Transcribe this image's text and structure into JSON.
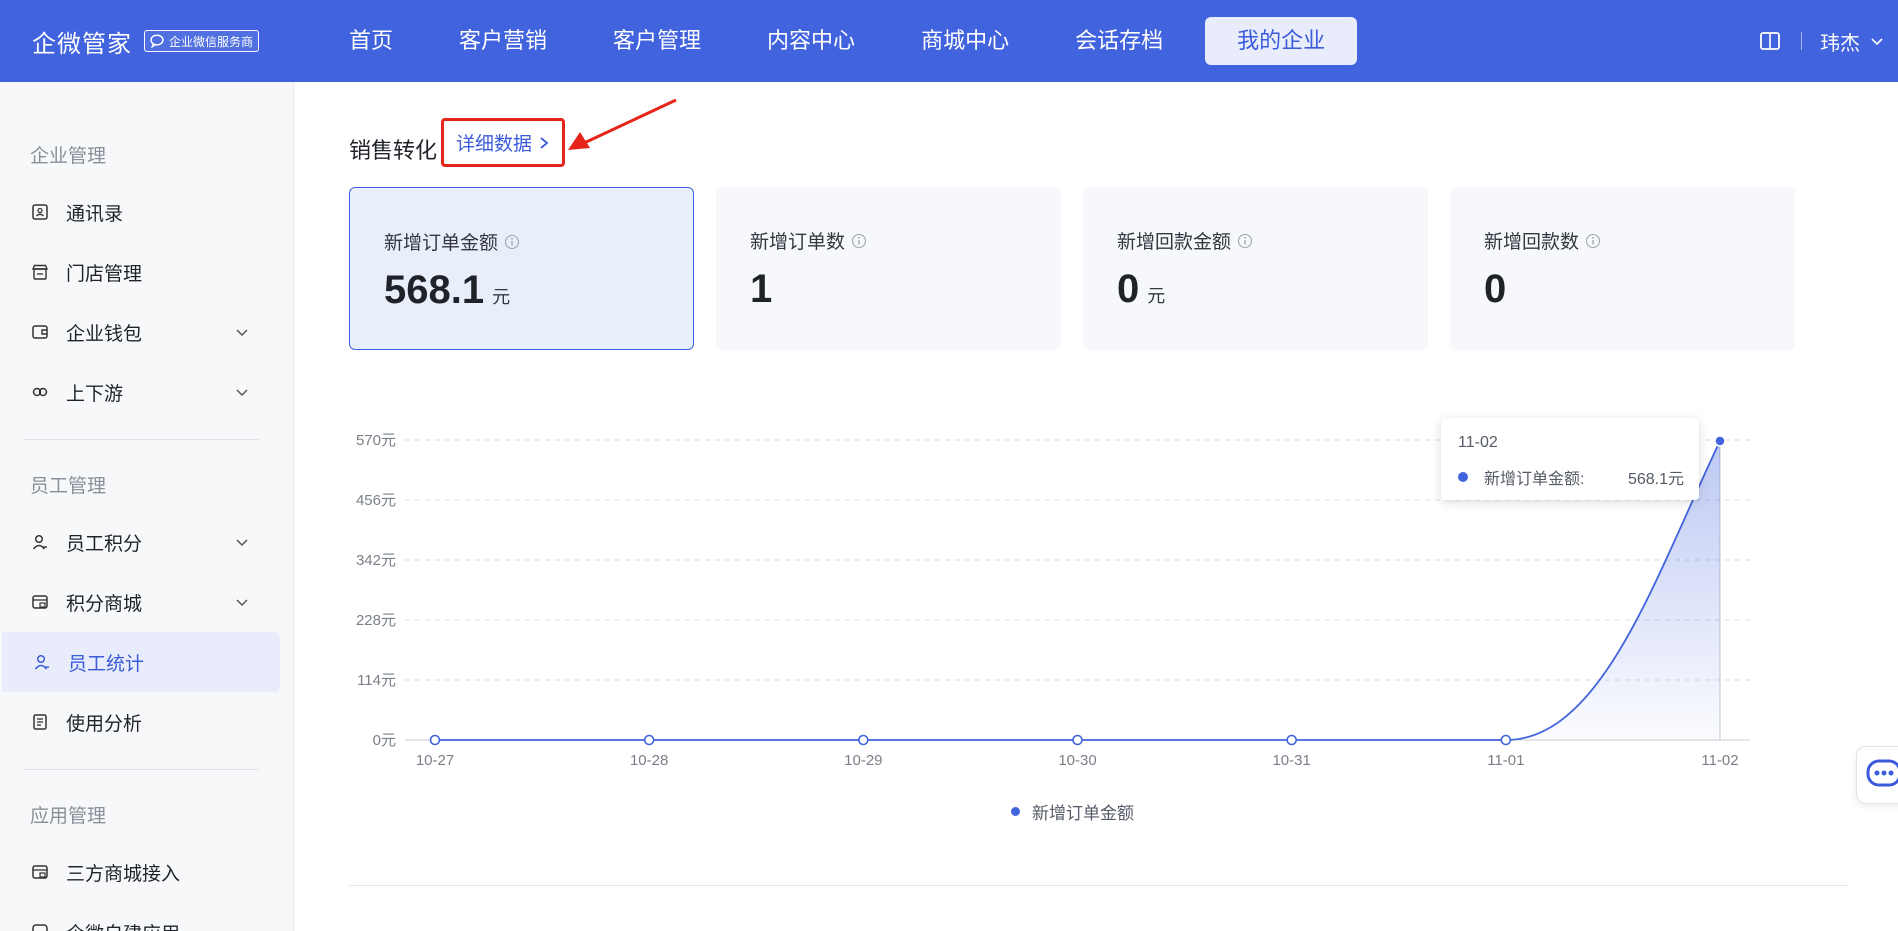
{
  "brand": {
    "name": "企微管家",
    "badge": "企业微信服务商"
  },
  "nav": {
    "items": [
      {
        "label": "首页"
      },
      {
        "label": "客户营销"
      },
      {
        "label": "客户管理"
      },
      {
        "label": "内容中心"
      },
      {
        "label": "商城中心"
      },
      {
        "label": "会话存档"
      },
      {
        "label": "我的企业",
        "active": true
      }
    ]
  },
  "user": {
    "name": "玮杰"
  },
  "sidebar": {
    "groups": [
      {
        "title": "企业管理"
      },
      {
        "title": "员工管理"
      },
      {
        "title": "应用管理"
      }
    ],
    "items": [
      {
        "label": "通讯录",
        "icon": "contacts-icon"
      },
      {
        "label": "门店管理",
        "icon": "store-icon"
      },
      {
        "label": "企业钱包",
        "icon": "wallet-icon",
        "expandable": true
      },
      {
        "label": "上下游",
        "icon": "link-icon",
        "expandable": true
      },
      {
        "label": "员工积分",
        "icon": "user-icon",
        "expandable": true
      },
      {
        "label": "积分商城",
        "icon": "shop-icon",
        "expandable": true
      },
      {
        "label": "员工统计",
        "icon": "user-stats-icon",
        "active": true
      },
      {
        "label": "使用分析",
        "icon": "analysis-icon"
      },
      {
        "label": "三方商城接入",
        "icon": "mall-icon"
      },
      {
        "label": "企微自建应用",
        "icon": "app-icon"
      }
    ]
  },
  "section": {
    "title": "销售转化",
    "detail_link": "详细数据"
  },
  "cards": [
    {
      "label": "新增订单金额",
      "value": "568.1",
      "unit": "元",
      "active": true
    },
    {
      "label": "新增订单数",
      "value": "1",
      "unit": ""
    },
    {
      "label": "新增回款金额",
      "value": "0",
      "unit": "元"
    },
    {
      "label": "新增回款数",
      "value": "0",
      "unit": ""
    }
  ],
  "chart_data": {
    "type": "area",
    "categories": [
      "10-27",
      "10-28",
      "10-29",
      "10-30",
      "10-31",
      "11-01",
      "11-02"
    ],
    "series": [
      {
        "name": "新增订单金额",
        "values": [
          0,
          0,
          0,
          0,
          0,
          0,
          568.1
        ]
      }
    ],
    "ylim": [
      0,
      570
    ],
    "yticks": [
      "0元",
      "114元",
      "228元",
      "342元",
      "456元",
      "570元"
    ],
    "grid": true,
    "legend": "bottom-center",
    "colors": {
      "line": "#4263de"
    },
    "tooltip": {
      "date": "11-02",
      "name": "新增订单金额:",
      "value": "568.1元"
    }
  }
}
